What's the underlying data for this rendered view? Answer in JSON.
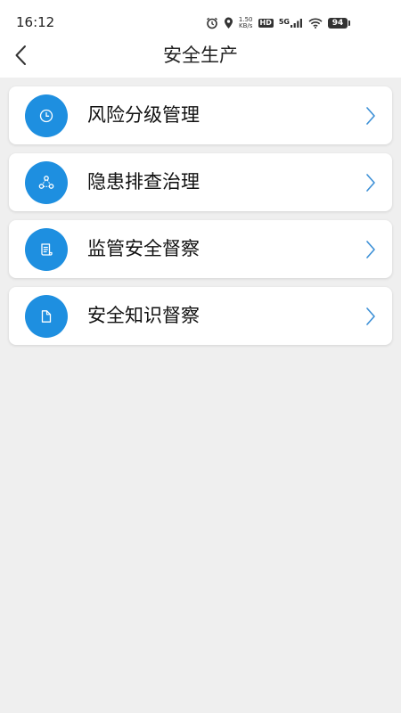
{
  "status_bar": {
    "time": "16:12",
    "speed_value": "1.50",
    "speed_unit": "KB/s",
    "hd_label": "HD",
    "network_label": "5G",
    "battery_level": "94"
  },
  "header": {
    "title": "安全生产",
    "back_icon": "chevron-left-icon"
  },
  "menu": {
    "items": [
      {
        "label": "风险分级管理",
        "icon": "clock-icon"
      },
      {
        "label": "隐患排查治理",
        "icon": "share-nodes-icon"
      },
      {
        "label": "监管安全督察",
        "icon": "scroll-icon"
      },
      {
        "label": "安全知识督察",
        "icon": "file-icon"
      }
    ]
  },
  "colors": {
    "accent": "#1e8fe0",
    "chevron": "#3b8fd6",
    "background": "#efefef",
    "card": "#ffffff"
  }
}
